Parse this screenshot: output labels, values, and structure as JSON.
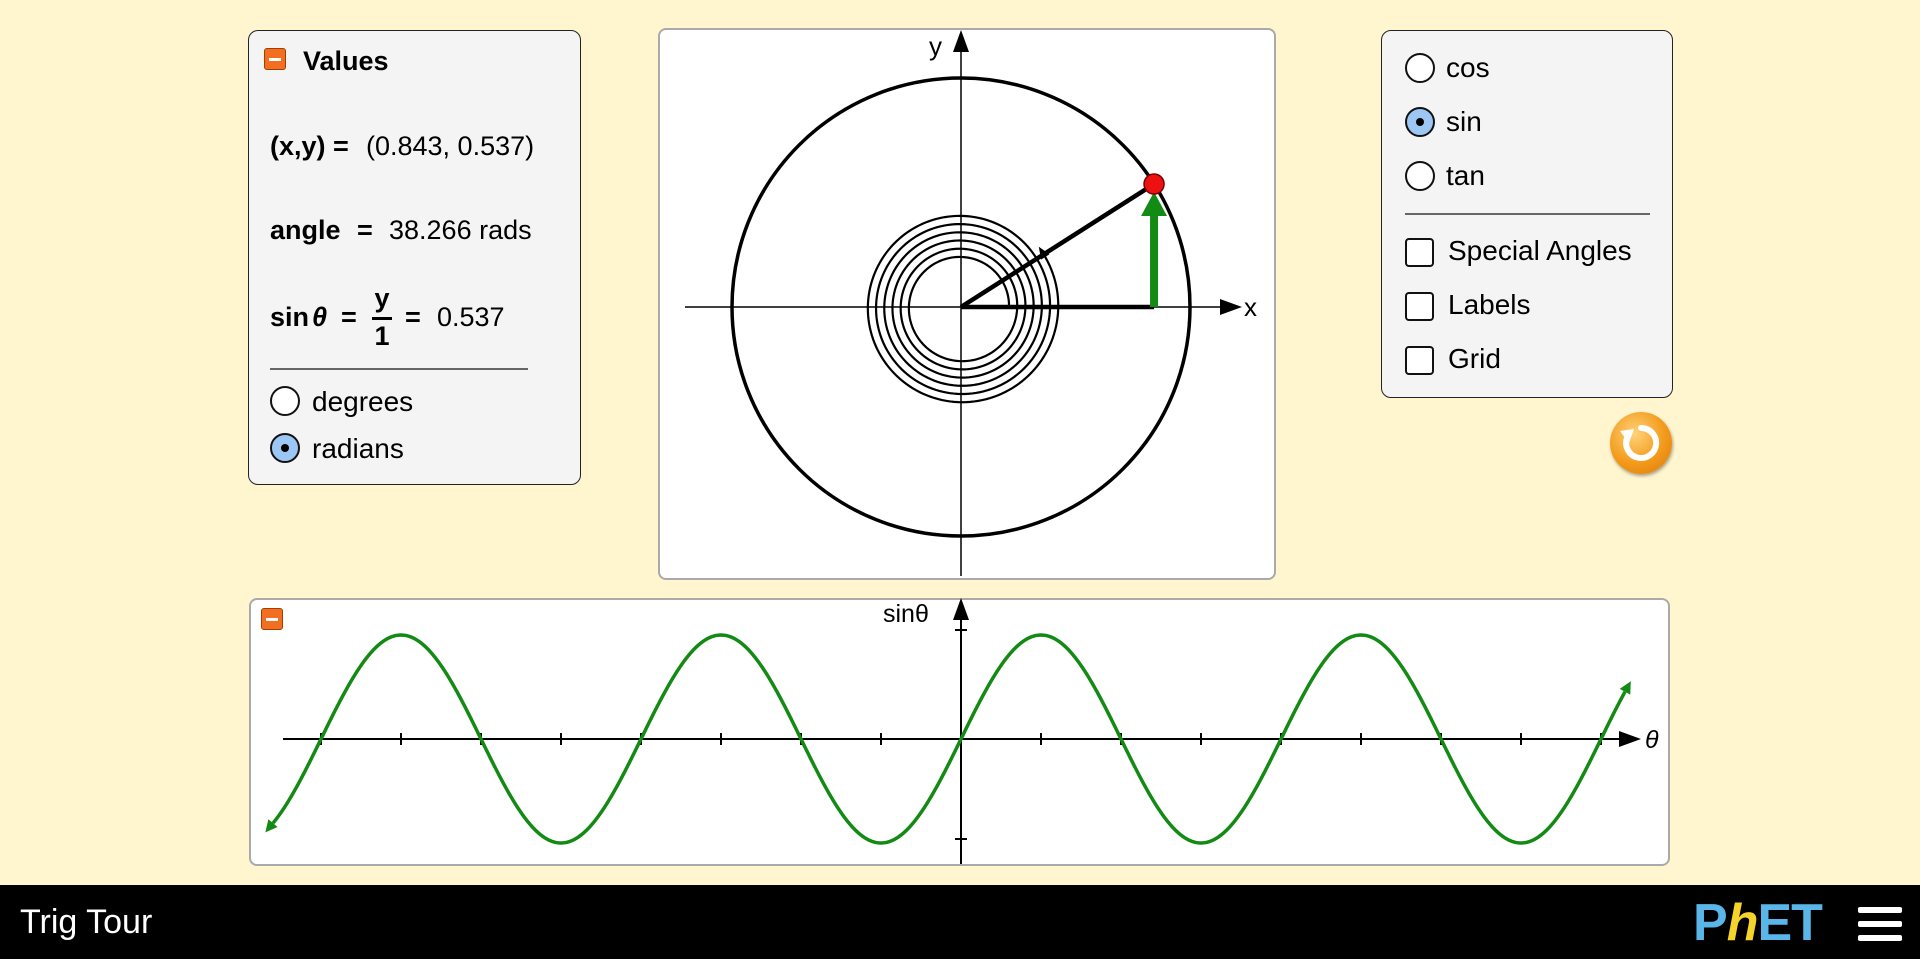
{
  "app": {
    "title": "Trig Tour"
  },
  "values_panel": {
    "title": "Values",
    "xy_label": "(x,y) =",
    "xy_value": "(0.843, 0.537)",
    "angle_label": "angle",
    "angle_eq": "=",
    "angle_value": "38.266 rads",
    "func_label": "sin",
    "theta": "θ",
    "frac_num": "y",
    "frac_den": "1",
    "eq1": "=",
    "eq2": "=",
    "func_value": "0.537",
    "units": [
      {
        "label": "degrees",
        "selected": false
      },
      {
        "label": "radians",
        "selected": true
      }
    ]
  },
  "unit_circle": {
    "x_axis_label": "x",
    "y_axis_label": "y",
    "point_x": 0.843,
    "point_y": 0.537,
    "turns": 6
  },
  "function_panel": {
    "options": [
      {
        "label": "cos",
        "selected": false
      },
      {
        "label": "sin",
        "selected": true
      },
      {
        "label": "tan",
        "selected": false
      }
    ],
    "checkboxes": [
      {
        "label": "Special Angles",
        "checked": false
      },
      {
        "label": "Labels",
        "checked": false
      },
      {
        "label": "Grid",
        "checked": false
      }
    ]
  },
  "graph": {
    "y_label": "sinθ",
    "x_label": "θ",
    "curve_color": "#138a13"
  },
  "colors": {
    "background": "#fff6cf",
    "accent_orange": "#f26f21",
    "point_red": "#ee1111",
    "vector_green": "#138a13",
    "logo_blue": "#5ab6e8"
  },
  "icons": {
    "reset": "reset-arrow-icon",
    "menu": "hamburger-menu-icon",
    "minimize": "minimize-icon"
  },
  "navbar": {
    "logo": "PhET"
  }
}
